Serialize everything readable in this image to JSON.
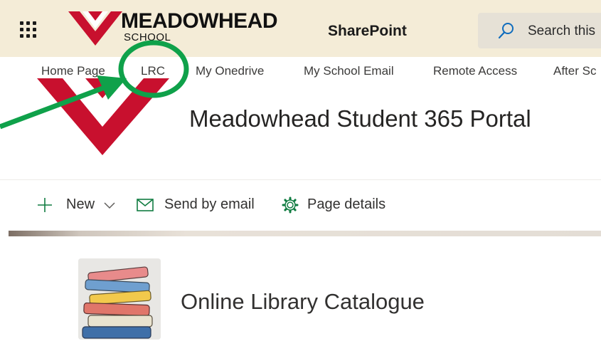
{
  "suite_bar": {
    "logo_name": "MEADOWHEAD",
    "logo_sub": "SCHOOL",
    "app_title": "SharePoint",
    "search_placeholder": "Search this",
    "colors": {
      "background": "#f4ecd7",
      "brand_red": "#c8102e"
    }
  },
  "hub_nav": {
    "items": [
      "Home Page",
      "LRC",
      "My Onedrive",
      "My School Email",
      "Remote Access",
      "After Sc"
    ]
  },
  "page": {
    "title": "Meadowhead Student 365 Portal"
  },
  "command_bar": {
    "new_label": "New",
    "send_label": "Send by email",
    "details_label": "Page details",
    "accent_color": "#107c41"
  },
  "quick_links": [
    {
      "label": "Online Library Catalogue",
      "icon": "books-stack-icon"
    }
  ],
  "annotation": {
    "color": "#0fa14a",
    "target": "LRC"
  }
}
